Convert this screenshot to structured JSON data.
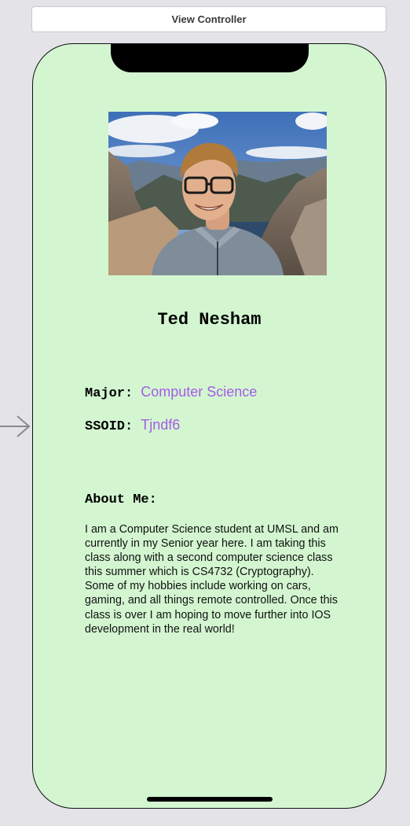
{
  "canvas": {
    "scene_title": "View Controller"
  },
  "profile": {
    "photo": "profile-photo",
    "name": "Ted Nesham",
    "major_label": "Major:",
    "major_value": "Computer Science",
    "ssoid_label": "SSOID:",
    "ssoid_value": "Tjndf6"
  },
  "about": {
    "heading": "About Me:",
    "body": "I am a Computer Science student at UMSL and am currently in my Senior year here. I am taking this class along with a second computer science class this summer which is CS4732 (Cryptography). Some of my hobbies include working on cars, gaming, and all things remote controlled. Once this class is over I am hoping to move further into IOS development in the real world!"
  },
  "colors": {
    "screen_background": "#d3f6d1",
    "value_text": "#a55be6",
    "canvas_background": "#e3e3e8"
  },
  "icons": {
    "entry_point": "arrow-right-icon"
  }
}
